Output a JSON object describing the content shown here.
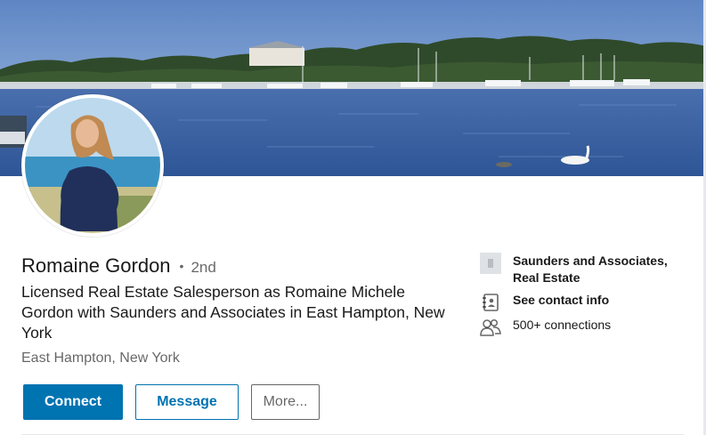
{
  "profile": {
    "name": "Romaine Gordon",
    "separator": "•",
    "degree": "2nd",
    "headline": "Licensed Real Estate Salesperson as Romaine Michele Gordon with Saunders and Associates in East Hampton, New York",
    "location": "East Hampton, New York"
  },
  "actions": {
    "connect_label": "Connect",
    "message_label": "Message",
    "more_label": "More..."
  },
  "sidebar": {
    "company": "Saunders and Associates, Real Estate",
    "contact_info": "See contact info",
    "connections": "500+ connections"
  },
  "colors": {
    "accent": "#0073b1",
    "text_secondary": "#666666"
  },
  "icons": {
    "company": "building-icon",
    "contact": "address-book-icon",
    "connections": "people-icon"
  }
}
